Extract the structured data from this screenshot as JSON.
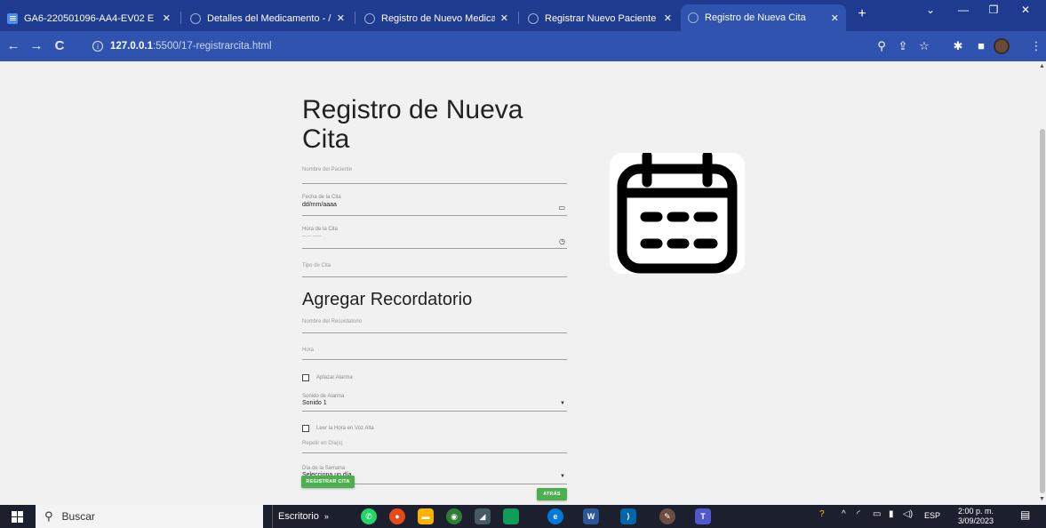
{
  "browser": {
    "tabs": [
      {
        "title": "GA6-220501096-AA4-EV02 E",
        "icon": "docs-icon",
        "active": false
      },
      {
        "title": "Detalles del Medicamento - /",
        "icon": "globe-icon",
        "active": false
      },
      {
        "title": "Registro de Nuevo Medicam",
        "icon": "globe-icon",
        "active": false
      },
      {
        "title": "Registrar Nuevo Paciente",
        "icon": "globe-icon",
        "active": false
      },
      {
        "title": "Registro de Nueva Cita",
        "icon": "globe-icon",
        "active": true
      }
    ],
    "url_host": "127.0.0.1",
    "url_path": ":5500/17-registrarcita.html",
    "colors": {
      "tabstrip": "#1f3b8f",
      "toolbar": "#3153b0"
    }
  },
  "form": {
    "title": "Registro de Nueva Cita",
    "patient_name_label": "Nombre del Paciente",
    "date_label": "Fecha de la Cita",
    "date_value": "dd/mm/aaaa",
    "time_label": "Hora de la Cita",
    "time_value": "--:-- -----",
    "type_label": "Tipo de Cita",
    "reminder_heading": "Agregar Recordatorio",
    "reminder_name_label": "Nombre del Recordatorio",
    "hour_label": "Hora",
    "snooze_label": "Aplazar Alarma",
    "sound_label": "Sonido de Alarma",
    "sound_value": "Sonido 1",
    "read_aloud_label": "Leer la Hora en Voz Alta",
    "repeat_label": "Repetir en Día(s)",
    "weekday_label": "Día de la Semana",
    "weekday_value": "Selecciona un día",
    "submit_label": "REGISTRAR CITA",
    "back_label": "ATRÁS",
    "button_color": "#4caf50"
  },
  "illustration": {
    "icon": "calendar-icon"
  },
  "taskbar": {
    "search_label": "Buscar",
    "desktop_label": "Escritorio",
    "language": "ESP",
    "time": "2:00 p. m.",
    "date": "3/09/2023"
  }
}
